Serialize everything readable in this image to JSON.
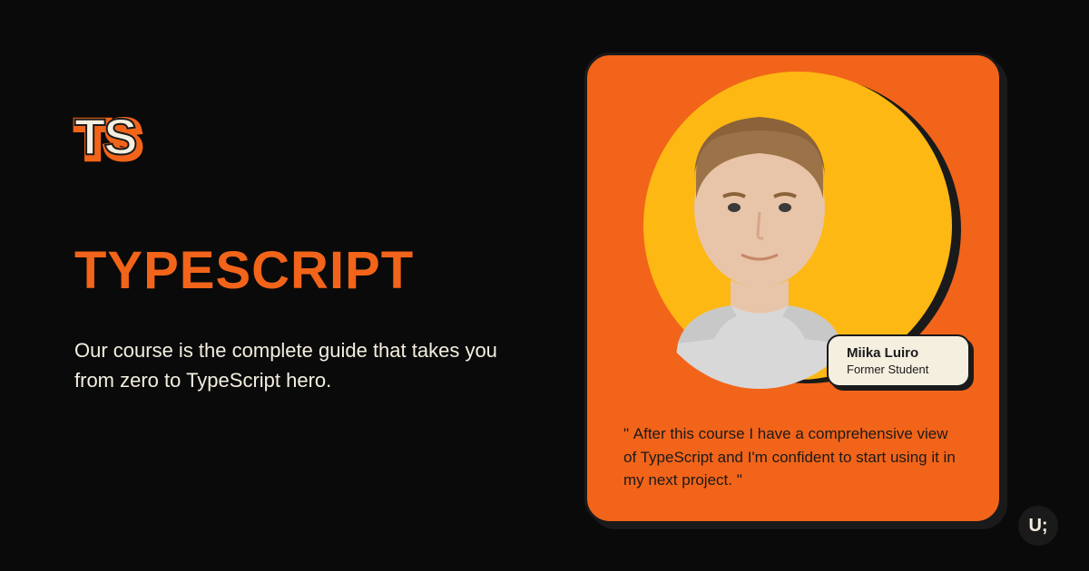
{
  "badge": {
    "text": "TS"
  },
  "title": "TYPESCRIPT",
  "subtitle": "Our course is the complete guide that takes you from zero to TypeScript hero.",
  "testimonial": {
    "name": "Miika Luiro",
    "role": "Former Student",
    "quote": "After this course I have a comprehensive view of TypeScript and I'm confident to start using it in my next project."
  },
  "logo": "U;"
}
